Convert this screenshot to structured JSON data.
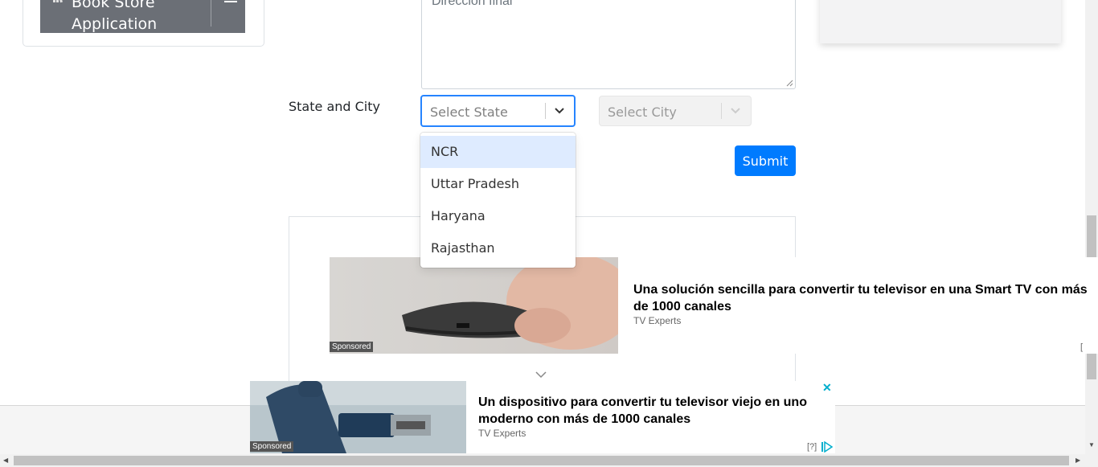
{
  "sidebar": {
    "app_name": "Book Store Application"
  },
  "form": {
    "address_placeholder": "Dirección final",
    "state_city_label": "State and City",
    "state_placeholder": "Select State",
    "city_placeholder": "Select City",
    "submit_label": "Submit",
    "state_options": [
      "NCR",
      "Uttar Pradesh",
      "Haryana",
      "Rajasthan"
    ]
  },
  "ads": {
    "ad1": {
      "sponsored": "Sponsored",
      "headline": "Una solución sencilla para convertir tu televisor en una Smart TV con más de 1000 canales",
      "source": "TV Experts",
      "bracket": "["
    },
    "ad2": {
      "sponsored": "Sponsored",
      "headline": "Un dispositivo para convertir tu televisor viejo en uno moderno con más de 1000 canales",
      "source": "TV Experts",
      "close": "✕",
      "help": "[?]"
    }
  },
  "colors": {
    "primary": "#007bff",
    "focus_border": "#2684ff",
    "option_highlight": "#deebff"
  },
  "icons": [
    "book-icon",
    "download-icon",
    "chevron-down-icon",
    "close-icon",
    "adchoices-icon"
  ]
}
